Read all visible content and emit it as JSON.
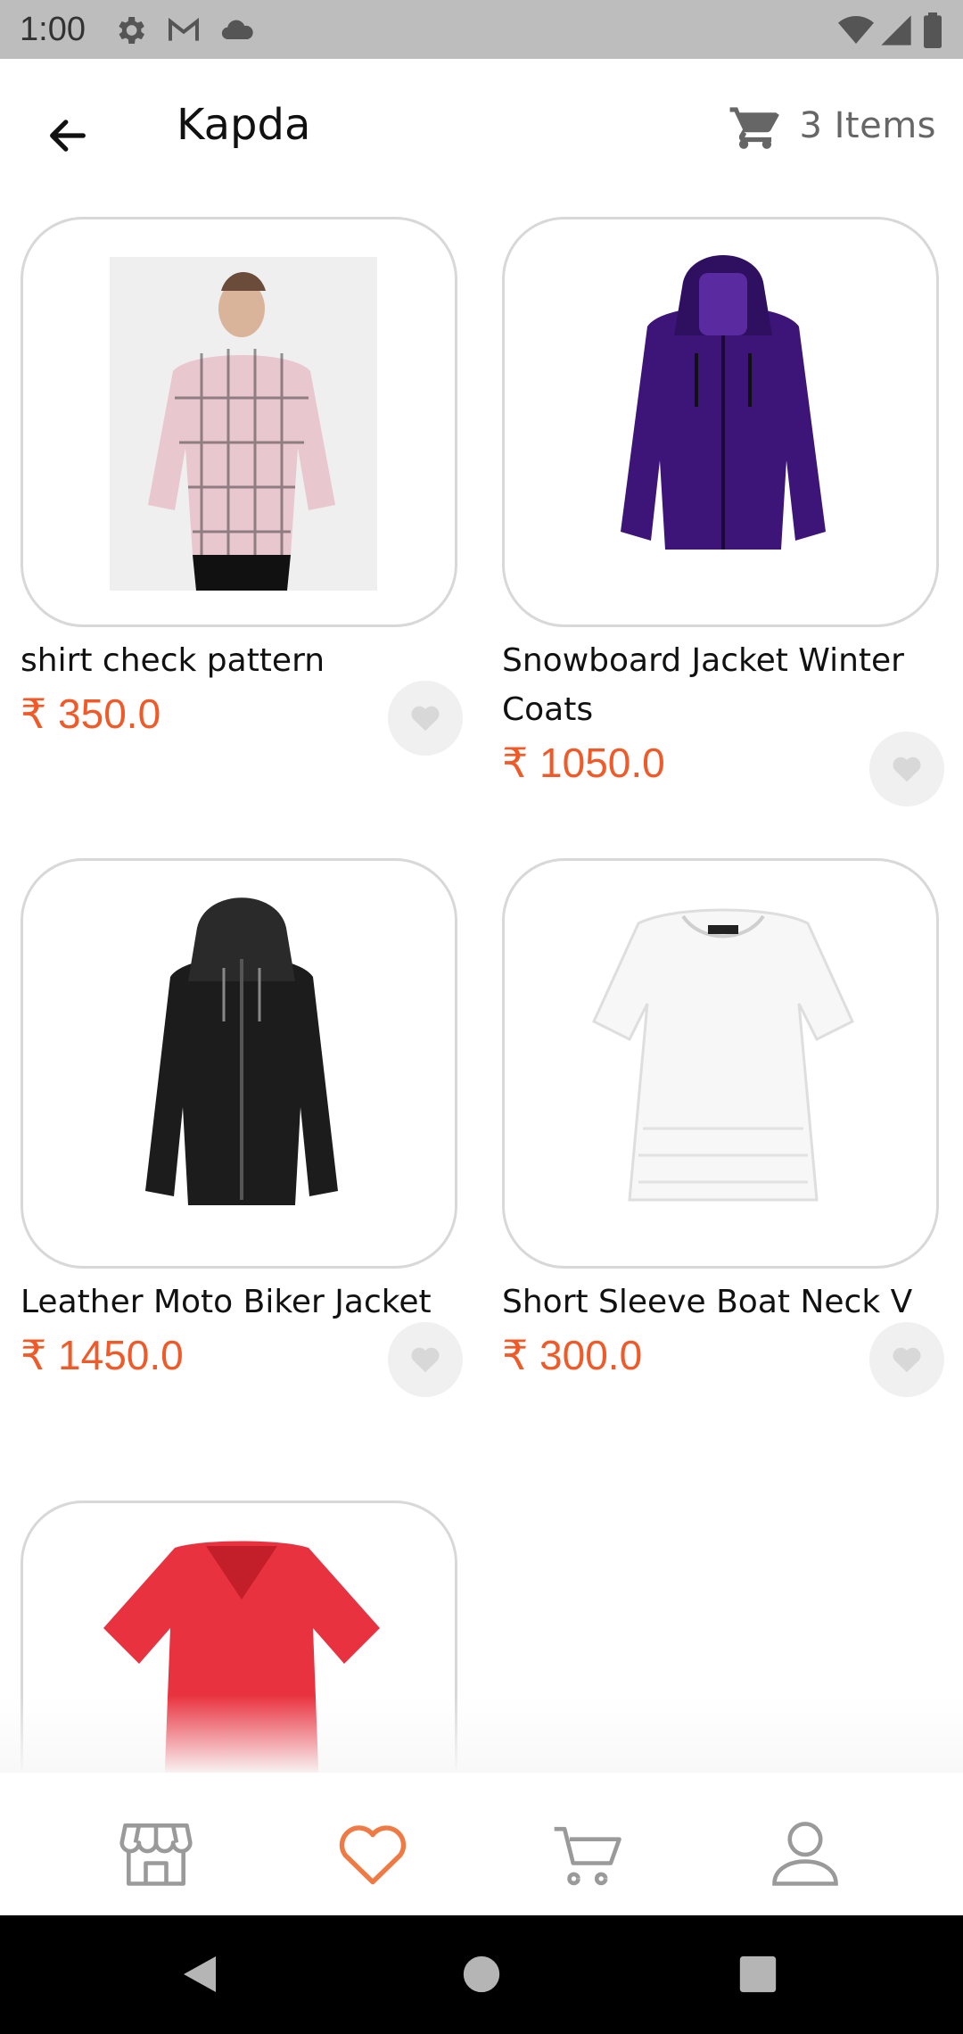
{
  "status_bar": {
    "time": "1:00"
  },
  "app_bar": {
    "title": "Kapda",
    "cart_label": "3 Items"
  },
  "products": [
    {
      "name": "shirt check pattern",
      "price": "₹ 350.0",
      "image": "checked-shirt-image"
    },
    {
      "name": "Snowboard Jacket Winter Coats",
      "price": "₹ 1050.0",
      "image": "purple-jacket-image"
    },
    {
      "name": "Leather Moto Biker Jacket",
      "price": "₹ 1450.0",
      "image": "black-leather-jacket-image"
    },
    {
      "name": "Short Sleeve Boat Neck V",
      "price": "₹ 300.0",
      "image": "white-top-image"
    },
    {
      "name": "",
      "price": "",
      "image": "red-tshirt-image"
    }
  ],
  "colors": {
    "accent": "#f05a28",
    "card_border": "#d8d8d8",
    "status_bar": "#bdbdbd"
  },
  "bottom_nav": [
    "store-icon",
    "heart-icon",
    "cart-icon",
    "profile-icon"
  ]
}
